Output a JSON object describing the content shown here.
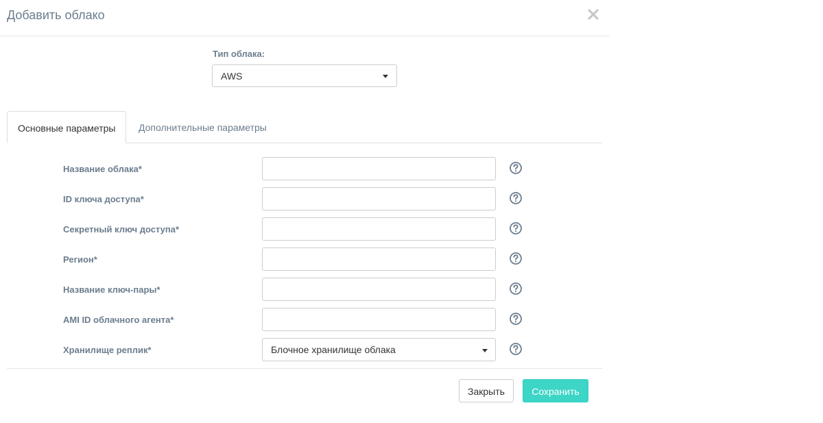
{
  "dialog": {
    "title": "Добавить облако",
    "close_icon": "close-x-icon"
  },
  "cloud_type": {
    "label": "Тип облака:",
    "selected": "AWS"
  },
  "tabs": [
    {
      "label": "Основные параметры",
      "active": true
    },
    {
      "label": "Дополнительные параметры",
      "active": false
    }
  ],
  "fields": [
    {
      "label": "Название облака*",
      "value": ""
    },
    {
      "label": "ID ключа доступа*",
      "value": ""
    },
    {
      "label": "Секретный ключ доступа*",
      "value": ""
    },
    {
      "label": "Регион*",
      "value": ""
    },
    {
      "label": "Название ключ-пары*",
      "value": ""
    },
    {
      "label": "AMI ID облачного агента*",
      "value": ""
    },
    {
      "label": "Хранилище реплик*",
      "selected": "Блочное хранилище облака"
    }
  ],
  "help_icon": "question-circle-icon",
  "buttons": {
    "close_label": "Закрыть",
    "save_label": "Сохранить"
  },
  "colors": {
    "accent": "#3dd5c6",
    "label": "#6b7d8e",
    "border": "#cccccc"
  }
}
